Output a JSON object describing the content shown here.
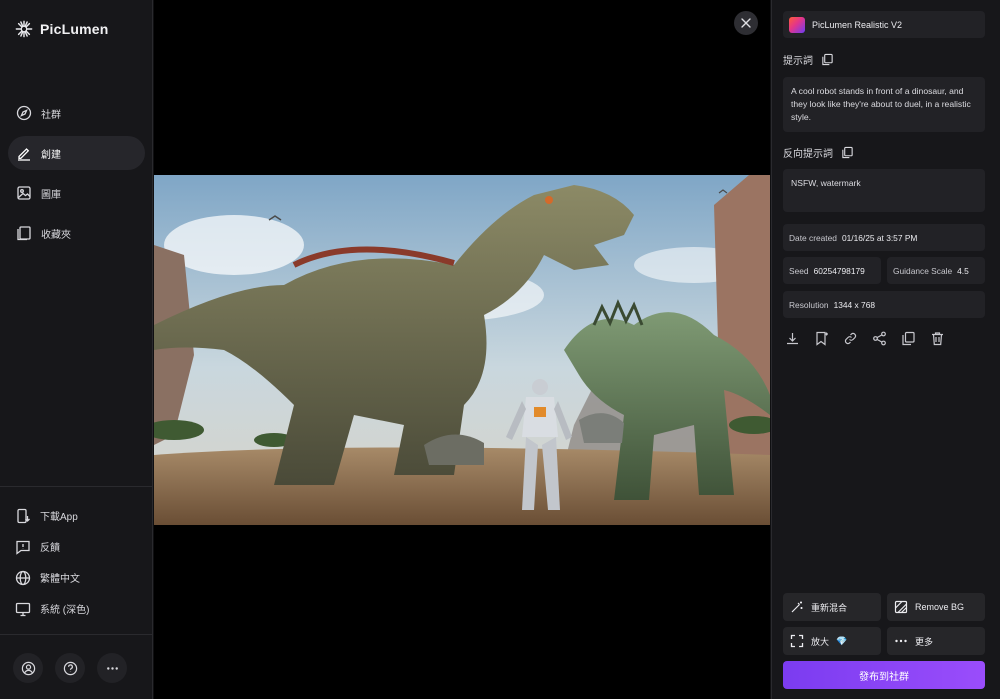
{
  "app": {
    "name": "PicLumen"
  },
  "sidebar": {
    "items": [
      {
        "label": "社群",
        "icon": "compass-icon"
      },
      {
        "label": "創建",
        "icon": "pen-icon",
        "active": true
      },
      {
        "label": "圖庫",
        "icon": "gallery-icon"
      },
      {
        "label": "收藏夾",
        "icon": "collection-icon"
      }
    ],
    "bottom_items": [
      {
        "label": "下載App",
        "icon": "download-app-icon"
      },
      {
        "label": "反饋",
        "icon": "feedback-icon"
      },
      {
        "label": "繁體中文",
        "icon": "globe-icon"
      },
      {
        "label": "系統 (深色)",
        "icon": "monitor-icon"
      }
    ]
  },
  "panel": {
    "model": "PicLumen Realistic V2",
    "prompt_label": "提示詞",
    "prompt": "A cool robot stands in front of a dinosaur, and they look like they're about to duel, in a realistic style.",
    "negative_label": "反向提示詞",
    "negative_prompt": "NSFW, watermark",
    "date_label": "Date created",
    "date_value": "01/16/25 at 3:57 PM",
    "seed_label": "Seed",
    "seed_value": "60254798179",
    "guidance_label": "Guidance Scale",
    "guidance_value": "4.5",
    "resolution_label": "Resolution",
    "resolution_value": "1344 x 768",
    "buttons": {
      "remix": "重新混合",
      "remove_bg": "Remove BG",
      "upscale": "放大",
      "more": "更多",
      "publish": "發布到社群"
    }
  },
  "colors": {
    "accent": "#8b45f5",
    "premium": "#f2c43b"
  }
}
